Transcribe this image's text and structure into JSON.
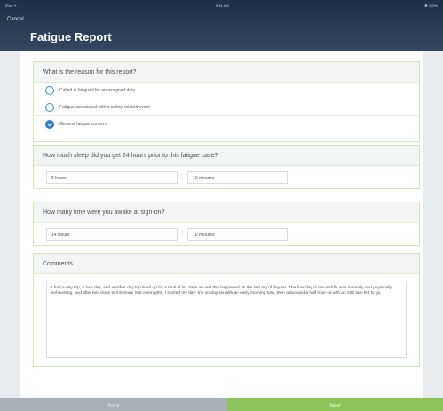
{
  "status_bar": {
    "left": "iPad ᯤ",
    "time": "9:41 AM",
    "right": "✱ 100%"
  },
  "header": {
    "cancel_label": "Cancel",
    "title": "Fatigue Report"
  },
  "reason": {
    "question": "What is the reason for this report?",
    "options": [
      {
        "label": "Called in fatigued for an assigned duty",
        "selected": false
      },
      {
        "label": "Fatigue associated with a safety-related event",
        "selected": false
      },
      {
        "label": "General fatigue concern",
        "selected": true
      }
    ]
  },
  "sleep": {
    "question": "How much sleep did you get 24 hours prior to this fatigue case?",
    "hours": "6 hours",
    "minutes": "10 minutes"
  },
  "awake": {
    "question": "How many time were you awake at sign-on?",
    "hours": "14 Hours",
    "minutes": "10 minutes"
  },
  "comments": {
    "label": "Comments",
    "text": "I had a day trip, a four day, and another day trip lined up for a total of six days on and this happened on the last leg of day six. The four day in the middle was mentally and physically exhausting, and after two close to minimum rest overnights, I started my day- trip on day six with an early morning turn, then a two and a half hour sit with an 222 turn left to go."
  },
  "footer": {
    "back_label": "Back",
    "next_label": "Next"
  },
  "colors": {
    "accent_blue": "#2a7ed0",
    "next_green": "#8cc45b",
    "header_navy": "#1e3046"
  }
}
